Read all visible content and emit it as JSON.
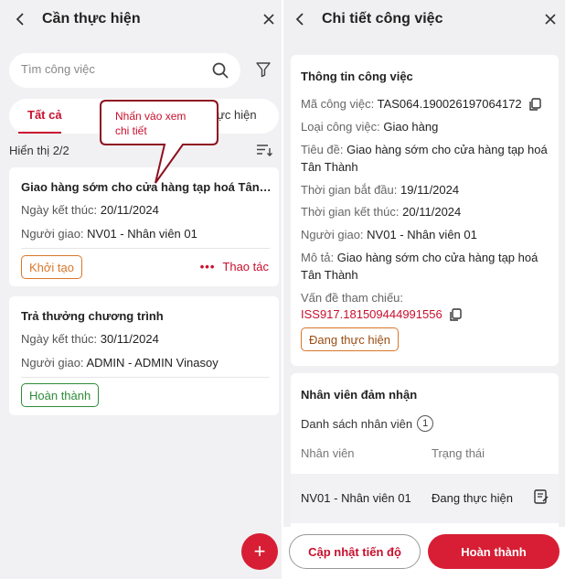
{
  "left": {
    "title": "Cần thực hiện",
    "search": {
      "placeholder": "Tìm công việc"
    },
    "tabs": [
      {
        "label": "Tất cả",
        "active": true
      },
      {
        "label": "H"
      },
      {
        "label": "hực hiện"
      }
    ],
    "count_label": "Hiển thị 2/2",
    "tasks": [
      {
        "title": "Giao hàng sớm  cho cửa hàng tạp hoá Tân T...",
        "end_label": "Ngày kết thúc:",
        "end_value": "20/11/2024",
        "assigner_label": "Người giao:",
        "assigner_value": "NV01 - Nhân viên 01",
        "status": "Khởi tạo",
        "action": "Thao tác"
      },
      {
        "title": "Trả thưởng chương trình",
        "end_label": "Ngày kết thúc:",
        "end_value": "30/11/2024",
        "assigner_label": "Người giao:",
        "assigner_value": "ADMIN - ADMIN Vinasoy",
        "status": "Hoàn thành"
      }
    ],
    "fab_label": "+"
  },
  "callout": {
    "line1": "Nhấn vào xem",
    "line2": "chi tiết"
  },
  "right": {
    "title": "Chi tiết công việc",
    "info": {
      "section_title": "Thông tin công việc",
      "code_label": "Mã công việc:",
      "code_value": "TAS064.190026197064172",
      "type_label": "Loại công việc:",
      "type_value": "Giao hàng",
      "subject_label": "Tiêu đề:",
      "subject_value": "Giao hàng sớm  cho cửa hàng tạp hoá Tân Thành",
      "start_label": "Thời gian bắt đầu:",
      "start_value": "19/11/2024",
      "end_label": "Thời gian kết thúc:",
      "end_value": "20/11/2024",
      "assigner_label": "Người giao:",
      "assigner_value": "NV01 - Nhân viên 01",
      "desc_label": "Mô tả:",
      "desc_value": "Giao hàng sớm  cho cửa hàng tạp hoá Tân Thành",
      "ref_label": "Vấn đề tham chiếu:",
      "ref_value": "ISS917.181509444991556",
      "status": "Đang thực hiện"
    },
    "assignees": {
      "section_title": "Nhân viên đảm nhận",
      "list_label": "Danh sách nhân viên",
      "list_count": "1",
      "col_employee": "Nhân viên",
      "col_status": "Trạng thái",
      "rows": [
        {
          "employee": "NV01 - Nhân viên 01",
          "status": "Đang thực hiện"
        }
      ]
    },
    "buttons": {
      "update": "Cập nhật tiến độ",
      "complete": "Hoàn thành"
    }
  },
  "colors": {
    "accent": "#d71e34",
    "status_new": "#d9772a",
    "status_done": "#2e8b3a"
  }
}
